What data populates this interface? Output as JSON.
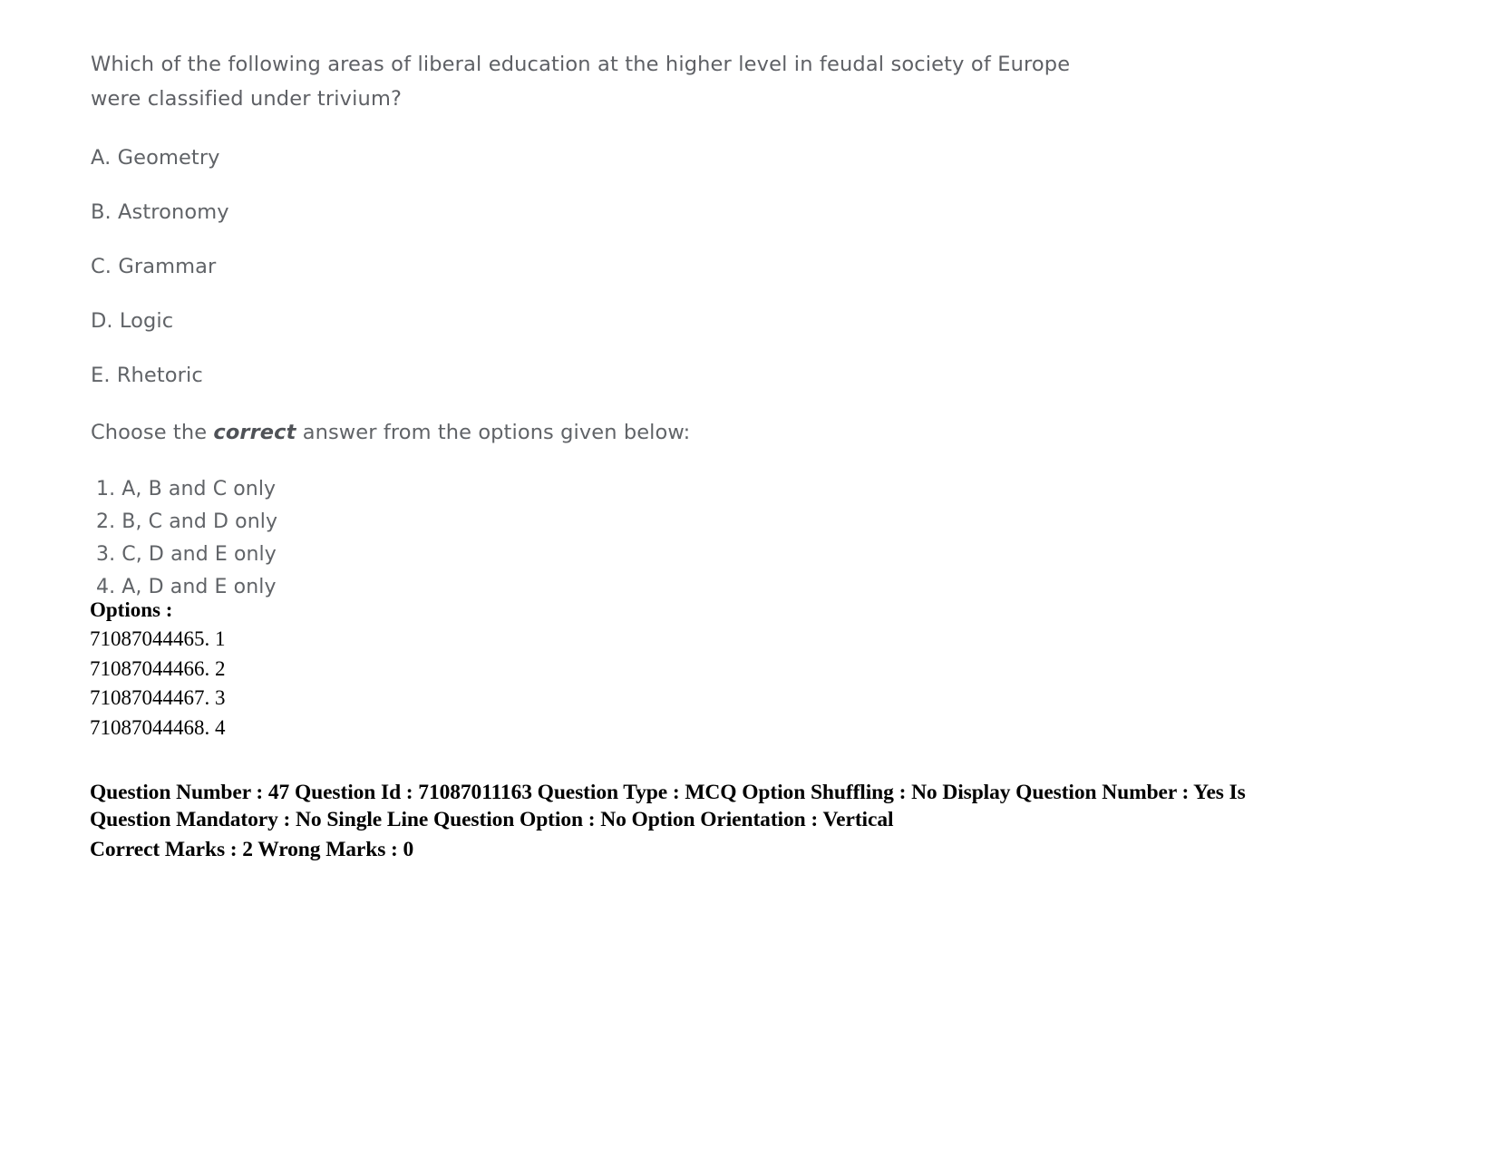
{
  "document": {
    "type": "exam-question-sheet",
    "background_color": "#ffffff",
    "scan_text_color": "#4d5055",
    "data_text_color": "#000000"
  },
  "question": {
    "stem": "Which of the following areas of liberal education at the higher level in feudal society of Europe were classified under trivium?",
    "stem_line_1": "Which of the following areas of liberal education at the higher level in feudal society of Europe",
    "stem_line_2": "were classified under trivium?",
    "statements": [
      "A. Geometry",
      "B. Astronomy",
      "C. Grammar",
      "D. Logic",
      "E. Rhetoric"
    ],
    "instruction": {
      "before": "Choose the ",
      "emphasis": "correct",
      "after": " answer from the options given below:"
    },
    "answer_choices": [
      "1. A, B and C only",
      "2. B, C and D only",
      "3. C, D and E only",
      "4. A, D and E only"
    ]
  },
  "options_section": {
    "heading": "Options :",
    "rows": [
      "71087044465. 1",
      "71087044466. 2",
      "71087044467. 3",
      "71087044468. 4"
    ]
  },
  "metadata": {
    "line_1": "Question Number : 47 Question Id : 71087011163 Question Type : MCQ Option Shuffling : No Display Question Number : Yes Is",
    "line_2": "Question Mandatory : No Single Line Question Option : No Option Orientation : Vertical",
    "line_3": "Correct Marks : 2 Wrong Marks : 0",
    "fields": {
      "question_number": "47",
      "question_id": "71087011163",
      "question_type": "MCQ",
      "option_shuffling": "No",
      "display_question_number": "Yes",
      "is_question_mandatory": "No",
      "single_line_question_option": "No",
      "option_orientation": "Vertical",
      "correct_marks": "2",
      "wrong_marks": "0"
    }
  }
}
